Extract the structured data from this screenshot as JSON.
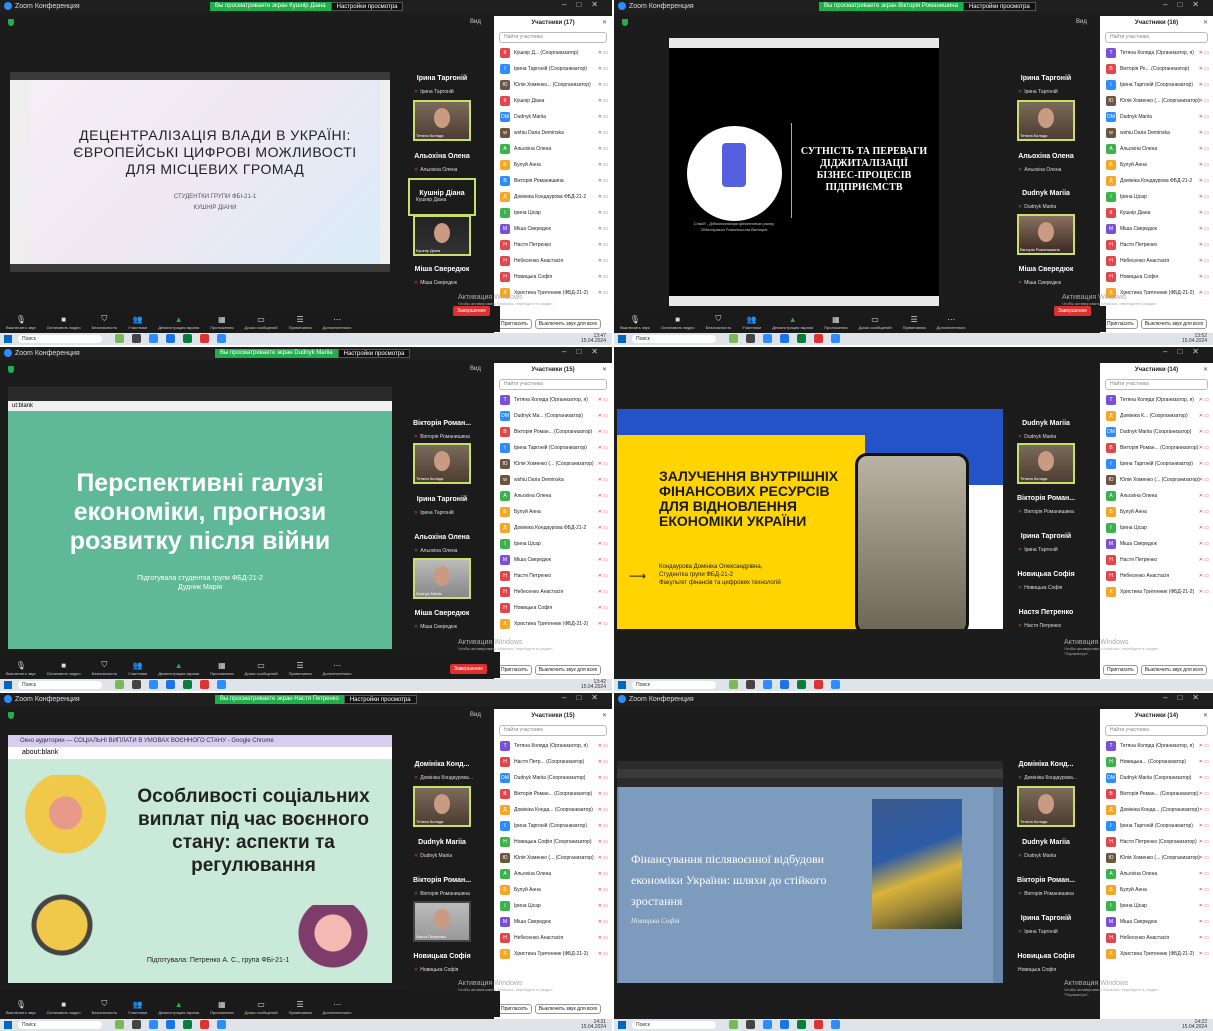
{
  "app_name": "Zoom Конференция",
  "toolbar_labels": {
    "mute": "Выключить звук",
    "video": "Остановить видео",
    "security": "Безопасность",
    "participants": "Участники",
    "share": "Демонстрация экрана",
    "apps": "Приложения",
    "whiteboards": "Доски сообщений",
    "reactions": "Примечания",
    "more": "Дополнительно",
    "end": "Завершение"
  },
  "participant_footer": {
    "invite": "Пригласить",
    "mute_all": "Выключить звук для всех"
  },
  "search_placeholder": "Найти участника",
  "view_label": "Вид",
  "windows_activation": {
    "title": "Активация Windows",
    "line1": "Чтобы активировать Windows, перейдите в раздел",
    "line2": "\"Параметры\"."
  },
  "taskbar_search": "Поиск",
  "panels": [
    {
      "share_banner": "Вы просматриваете экран Кушнір Діана",
      "view_options": "Настройки просмотра",
      "participants_title": "Участники (17)",
      "slide": {
        "title": "ДЕЦЕНТРАЛІЗАЦІЯ ВЛАДИ В УКРАЇНІ: ЄВРОПЕЙСЬКІ ЦИФРОВІ МОЖЛИВОСТІ ДЛЯ МІСЦЕВИХ ГРОМАД",
        "sub1": "СТУДЕНТКИ ГРУПИ ФБІ-21-1",
        "sub2": "КУШНІР ДІАНИ"
      },
      "gallery": [
        {
          "name": "Ірина Таргоній",
          "sub": "Ірина Таргоній"
        },
        {
          "name": "",
          "sub": "Тетяна Коляда",
          "face": true
        },
        {
          "name": "Альохіна Олена",
          "sub": "Альохіна Олена"
        },
        {
          "name": "Кушнір Діана",
          "sub": "Кушнір Діана"
        },
        {
          "name": "",
          "sub": "Кушнір Діана",
          "face": true
        },
        {
          "name": "Міша Свередюк",
          "sub": "Міша Свередюк"
        }
      ],
      "participants": [
        {
          "init": "К",
          "color": "#e2454a",
          "name": "Кушнір Д... (Соорганизатор)"
        },
        {
          "init": "І",
          "color": "#2d8cff",
          "name": "Ірина Таргоній (Соорганизатор)"
        },
        {
          "init": "Ю",
          "color": "#6b5540",
          "name": "Юлія Хоменко... (Соорганизатор)"
        },
        {
          "init": "К",
          "color": "#e2454a",
          "name": "Кушнір Діана"
        },
        {
          "init": "DM",
          "color": "#2d8cff",
          "name": "Dudnyk Mariia"
        },
        {
          "init": "w",
          "color": "#6b5540",
          "name": "wshiu Daria Deminska"
        },
        {
          "init": "А",
          "color": "#3bb34a",
          "name": "Альохіна Олена"
        },
        {
          "init": "Б",
          "color": "#f5a623",
          "name": "Булуй Анна"
        },
        {
          "init": "В",
          "color": "#2d8cff",
          "name": "Вікторія Романишина"
        },
        {
          "init": "Д",
          "color": "#f5a623",
          "name": "Домініка Кондаурова ФБД-21-2"
        },
        {
          "init": "І",
          "color": "#3bb34a",
          "name": "Ірина Цісар"
        },
        {
          "init": "М",
          "color": "#7b4fd8",
          "name": "Міша Свередюк"
        },
        {
          "init": "Н",
          "color": "#e2454a",
          "name": "Настя Петренко"
        },
        {
          "init": "Н",
          "color": "#e2454a",
          "name": "Небесенко Анастасія"
        },
        {
          "init": "Н",
          "color": "#e2454a",
          "name": "Новицька Софія"
        },
        {
          "init": "Х",
          "color": "#f5a623",
          "name": "Христина Тритенник (ФБД-21-2)"
        }
      ],
      "clock": {
        "time": "13:47",
        "date": "15.04.2024"
      }
    },
    {
      "share_banner": "Вы просматриваете экран Вікторія Романишина",
      "view_options": "Настройки просмотра",
      "participants_title": "Участники (16)",
      "slide": {
        "title": "СУТНІСТЬ ТА ПЕРЕВАГИ ДІДЖИТАЛІЗАЦІЇ БІЗНЕС-ПРОЦЕСІВ ПІДПРИЄМСТВ",
        "caption1": "Слайд - Діджиталізація фінансового ринку",
        "caption2": "Підготувала Романишина Вікторія"
      },
      "gallery": [
        {
          "name": "Ірина Таргоній",
          "sub": "Ірина Таргоній"
        },
        {
          "name": "",
          "sub": "Тетяна Коляда",
          "face": true
        },
        {
          "name": "Альохіна Олена",
          "sub": "Альохіна Олена"
        },
        {
          "name": "Dudnyk Mariia",
          "sub": "Dudnyk Mariia"
        },
        {
          "name": "",
          "sub": "Вікторія Романишина",
          "face": true
        },
        {
          "name": "Міша Свередюк",
          "sub": "Міша Свередюк"
        }
      ],
      "participants": [
        {
          "init": "Т",
          "color": "#7b4fd8",
          "name": "Тетяна Коляда (Организатор, я)"
        },
        {
          "init": "В",
          "color": "#e2454a",
          "name": "Вікторія Ро... (Соорганизатор)"
        },
        {
          "init": "І",
          "color": "#2d8cff",
          "name": "Ірина Таргоній (Соорганизатор)"
        },
        {
          "init": "Ю",
          "color": "#6b5540",
          "name": "Юлія Хоменко (... (Соорганизатор)"
        },
        {
          "init": "DM",
          "color": "#2d8cff",
          "name": "Dudnyk Mariia"
        },
        {
          "init": "w",
          "color": "#6b5540",
          "name": "wshiu Daria Deminska"
        },
        {
          "init": "А",
          "color": "#3bb34a",
          "name": "Альохіна Олена"
        },
        {
          "init": "Б",
          "color": "#f5a623",
          "name": "Булуй Анна"
        },
        {
          "init": "Д",
          "color": "#f5a623",
          "name": "Домініка Кондаурова ФБД-21-2"
        },
        {
          "init": "І",
          "color": "#3bb34a",
          "name": "Ірина Цісар"
        },
        {
          "init": "К",
          "color": "#e2454a",
          "name": "Кушнір Діана"
        },
        {
          "init": "М",
          "color": "#7b4fd8",
          "name": "Міша Свередюк"
        },
        {
          "init": "Н",
          "color": "#e2454a",
          "name": "Настя Петренко"
        },
        {
          "init": "Н",
          "color": "#e2454a",
          "name": "Небесенко Анастасія"
        },
        {
          "init": "Н",
          "color": "#e2454a",
          "name": "Новицька Софія"
        },
        {
          "init": "Х",
          "color": "#f5a623",
          "name": "Христина Тритенник (ФБД-21-2)"
        }
      ],
      "clock": {
        "time": "13:52",
        "date": "15.04.2024"
      }
    },
    {
      "share_banner": "Вы просматриваете экран Dudnyk Mariia",
      "view_options": "Настройки просмотра",
      "participants_title": "Участники (15)",
      "browser_url": "ut:blank",
      "slide": {
        "title": "Перспективні галузі економіки, прогнози розвитку після війни",
        "sub1": "Підготувала студентка групи ФБД-21-2",
        "sub2": "Дудник Марія"
      },
      "gallery": [
        {
          "name": "Вікторія Роман...",
          "sub": "Вікторія Романишина"
        },
        {
          "name": "",
          "sub": "Тетяна Коляда",
          "face": true
        },
        {
          "name": "Ірина Таргоній",
          "sub": "Ірина Таргоній"
        },
        {
          "name": "Альохіна Олена",
          "sub": "Альохіна Олена"
        },
        {
          "name": "",
          "sub": "Dudnyk Mariia",
          "face": true
        },
        {
          "name": "Міша Свередюк",
          "sub": "Міша Свередюк"
        }
      ],
      "participants": [
        {
          "init": "Т",
          "color": "#7b4fd8",
          "name": "Тетяна Коляда (Организатор, я)"
        },
        {
          "init": "DM",
          "color": "#2d8cff",
          "name": "Dudnyk Ma... (Соорганизатор)"
        },
        {
          "init": "В",
          "color": "#e2454a",
          "name": "Вікторія Роман... (Соорганизатор)"
        },
        {
          "init": "І",
          "color": "#2d8cff",
          "name": "Ірина Таргоній (Соорганизатор)"
        },
        {
          "init": "Ю",
          "color": "#6b5540",
          "name": "Юлія Хоменко (... (Соорганизатор)"
        },
        {
          "init": "w",
          "color": "#6b5540",
          "name": "wshiu Daria Deminska"
        },
        {
          "init": "А",
          "color": "#3bb34a",
          "name": "Альохіна Олена"
        },
        {
          "init": "Б",
          "color": "#f5a623",
          "name": "Булуй Анна"
        },
        {
          "init": "Д",
          "color": "#f5a623",
          "name": "Домініка Кондаурова ФБД-21-2"
        },
        {
          "init": "І",
          "color": "#3bb34a",
          "name": "Ірина Цісар"
        },
        {
          "init": "М",
          "color": "#7b4fd8",
          "name": "Міша Свередюк"
        },
        {
          "init": "Н",
          "color": "#e2454a",
          "name": "Настя Петренко"
        },
        {
          "init": "Н",
          "color": "#e2454a",
          "name": "Небесенко Анастасія"
        },
        {
          "init": "Н",
          "color": "#e2454a",
          "name": "Новицька Софія"
        },
        {
          "init": "Х",
          "color": "#f5a623",
          "name": "Христина Тритенник (ФБД-21-2)"
        }
      ],
      "clock": {
        "time": "13:42",
        "date": "15.04.2024"
      }
    },
    {
      "share_banner": "",
      "view_options": "",
      "participants_title": "Участники (14)",
      "slide": {
        "title": "ЗАЛУЧЕННЯ ВНУТРІШНІХ ФІНАНСОВИХ РЕСУРСІВ ДЛЯ ВІДНОВЛЕННЯ ЕКОНОМІКИ УКРАЇНИ",
        "sub1": "Кондаурова Домініка Олександрівна,",
        "sub2": "Студентка групи ФБД-21-2",
        "sub3": "Факультет фінансів та цифрових технологій"
      },
      "gallery": [
        {
          "name": "Dudnyk Mariia",
          "sub": "Dudnyk Mariia"
        },
        {
          "name": "",
          "sub": "Тетяна Коляда",
          "face": true
        },
        {
          "name": "Вікторія Роман...",
          "sub": "Вікторія Романишина"
        },
        {
          "name": "Ірина Таргоній",
          "sub": "Ірина Таргоній"
        },
        {
          "name": "Новицька Софія",
          "sub": "Новицька Софія"
        },
        {
          "name": "Настя Петренко",
          "sub": "Настя Петренко"
        }
      ],
      "participants": [
        {
          "init": "Т",
          "color": "#7b4fd8",
          "name": "Тетяна Коляда (Организатор, я)"
        },
        {
          "init": "Д",
          "color": "#f5a623",
          "name": "Домініка К... (Соорганизатор)"
        },
        {
          "init": "DM",
          "color": "#2d8cff",
          "name": "Dudnyk Mariia (Соорганизатор)"
        },
        {
          "init": "В",
          "color": "#e2454a",
          "name": "Вікторія Роман... (Соорганизатор)"
        },
        {
          "init": "І",
          "color": "#2d8cff",
          "name": "Ірина Таргоній (Соорганизатор)"
        },
        {
          "init": "Ю",
          "color": "#6b5540",
          "name": "Юлія Хоменко (... (Соорганизатор)"
        },
        {
          "init": "А",
          "color": "#3bb34a",
          "name": "Альохіна Олена"
        },
        {
          "init": "Б",
          "color": "#f5a623",
          "name": "Булуй Анна"
        },
        {
          "init": "І",
          "color": "#3bb34a",
          "name": "Ірина Цісар"
        },
        {
          "init": "М",
          "color": "#7b4fd8",
          "name": "Міша Свередюк"
        },
        {
          "init": "Н",
          "color": "#e2454a",
          "name": "Настя Петренко"
        },
        {
          "init": "Н",
          "color": "#e2454a",
          "name": "Небесенко Анастасія"
        },
        {
          "init": "Х",
          "color": "#f5a623",
          "name": "Христина Тритенник (ФБД-21-2)"
        }
      ],
      "clock": {
        "time": "",
        "date": ""
      }
    },
    {
      "share_banner": "Вы просматриваете экран Настя Петренко",
      "view_options": "Настройки просмотра",
      "participants_title": "Участники (15)",
      "browser_title": "Окно аудитории — СОЦІАЛЬНІ ВИПЛАТИ В УМОВАХ ВОЄННОГО СТАНУ - Google Chrome",
      "browser_url": "about:blank",
      "slide": {
        "title": "Особливості соціальних виплат під час воєнного стану: аспекти та регулювання",
        "sub1": "Підготувала: Петренко А. С., група ФБі-21-1"
      },
      "gallery": [
        {
          "name": "Домініка Конд...",
          "sub": "Домініка Кондаурова..."
        },
        {
          "name": "",
          "sub": "Тетяна Коляда",
          "face": true
        },
        {
          "name": "Dudnyk Mariia",
          "sub": "Dudnyk Mariia"
        },
        {
          "name": "Вікторія Роман...",
          "sub": "Вікторія Романишина"
        },
        {
          "name": "",
          "sub": "Настя Петренко",
          "face": true
        },
        {
          "name": "Новицька Софія",
          "sub": "Новицька Софія"
        }
      ],
      "participants": [
        {
          "init": "Т",
          "color": "#7b4fd8",
          "name": "Тетяна Коляда (Организатор, я)"
        },
        {
          "init": "Н",
          "color": "#e2454a",
          "name": "Настя Петр... (Соорганизатор)"
        },
        {
          "init": "DM",
          "color": "#2d8cff",
          "name": "Dudnyk Mariia (Соорганизатор)"
        },
        {
          "init": "В",
          "color": "#e2454a",
          "name": "Вікторія Роман... (Соорганизатор)"
        },
        {
          "init": "Д",
          "color": "#f5a623",
          "name": "Домініка Конда... (Соорганизатор)"
        },
        {
          "init": "І",
          "color": "#2d8cff",
          "name": "Ірина Таргоній (Соорганизатор)"
        },
        {
          "init": "Н",
          "color": "#3bb34a",
          "name": "Новицька Софія (Соорганизатор)"
        },
        {
          "init": "Ю",
          "color": "#6b5540",
          "name": "Юлія Хоменко (... (Соорганизатор)"
        },
        {
          "init": "А",
          "color": "#3bb34a",
          "name": "Альохіна Олена"
        },
        {
          "init": "Б",
          "color": "#f5a623",
          "name": "Булуй Анна"
        },
        {
          "init": "І",
          "color": "#3bb34a",
          "name": "Ірина Цісар"
        },
        {
          "init": "М",
          "color": "#7b4fd8",
          "name": "Міша Свередюк"
        },
        {
          "init": "Н",
          "color": "#e2454a",
          "name": "Небесенко Анастасія"
        },
        {
          "init": "Х",
          "color": "#f5a623",
          "name": "Христина Тритенник (ФБД-21-2)"
        }
      ],
      "clock": {
        "time": "14:31",
        "date": "15.04.2024"
      }
    },
    {
      "share_banner": "",
      "view_options": "",
      "participants_title": "Участники (14)",
      "slide": {
        "title": "Фінансування післявоєнної відбудови економіки України: шляхи до стійкого зростання",
        "sub1": "Новицька Софія"
      },
      "gallery": [
        {
          "name": "Домініка Конд...",
          "sub": "Домініка Кондаурова..."
        },
        {
          "name": "",
          "sub": "Тетяна Коляда",
          "face": true
        },
        {
          "name": "Dudnyk Mariia",
          "sub": "Dudnyk Mariia"
        },
        {
          "name": "Вікторія Роман...",
          "sub": "Вікторія Романишина"
        },
        {
          "name": "Ірина Таргоній",
          "sub": "Ірина Таргоній"
        },
        {
          "name": "Новицька Софія",
          "sub": "Новицька Софія"
        }
      ],
      "participants": [
        {
          "init": "Т",
          "color": "#7b4fd8",
          "name": "Тетяна Коляда (Организатор, я)"
        },
        {
          "init": "Н",
          "color": "#3bb34a",
          "name": "Новицька... (Соорганизатор)"
        },
        {
          "init": "DM",
          "color": "#2d8cff",
          "name": "Dudnyk Mariia (Соорганизатор)"
        },
        {
          "init": "В",
          "color": "#e2454a",
          "name": "Вікторія Роман... (Соорганизатор)"
        },
        {
          "init": "Д",
          "color": "#f5a623",
          "name": "Домініка Конда... (Соорганизатор)"
        },
        {
          "init": "І",
          "color": "#2d8cff",
          "name": "Ірина Таргоній (Соорганизатор)"
        },
        {
          "init": "Н",
          "color": "#e2454a",
          "name": "Настя Петренко (Соорганизатор)"
        },
        {
          "init": "Ю",
          "color": "#6b5540",
          "name": "Юлія Хоменко (... (Соорганизатор)"
        },
        {
          "init": "А",
          "color": "#3bb34a",
          "name": "Альохіна Олена"
        },
        {
          "init": "Б",
          "color": "#f5a623",
          "name": "Булуй Анна"
        },
        {
          "init": "І",
          "color": "#3bb34a",
          "name": "Ірина Цісар"
        },
        {
          "init": "М",
          "color": "#7b4fd8",
          "name": "Міша Свередюк"
        },
        {
          "init": "Н",
          "color": "#e2454a",
          "name": "Небесенко Анастасія"
        },
        {
          "init": "Х",
          "color": "#f5a623",
          "name": "Христина Тритенник (ФБД-21-2)"
        }
      ],
      "clock": {
        "time": "14:22",
        "date": "15.04.2024"
      }
    }
  ]
}
